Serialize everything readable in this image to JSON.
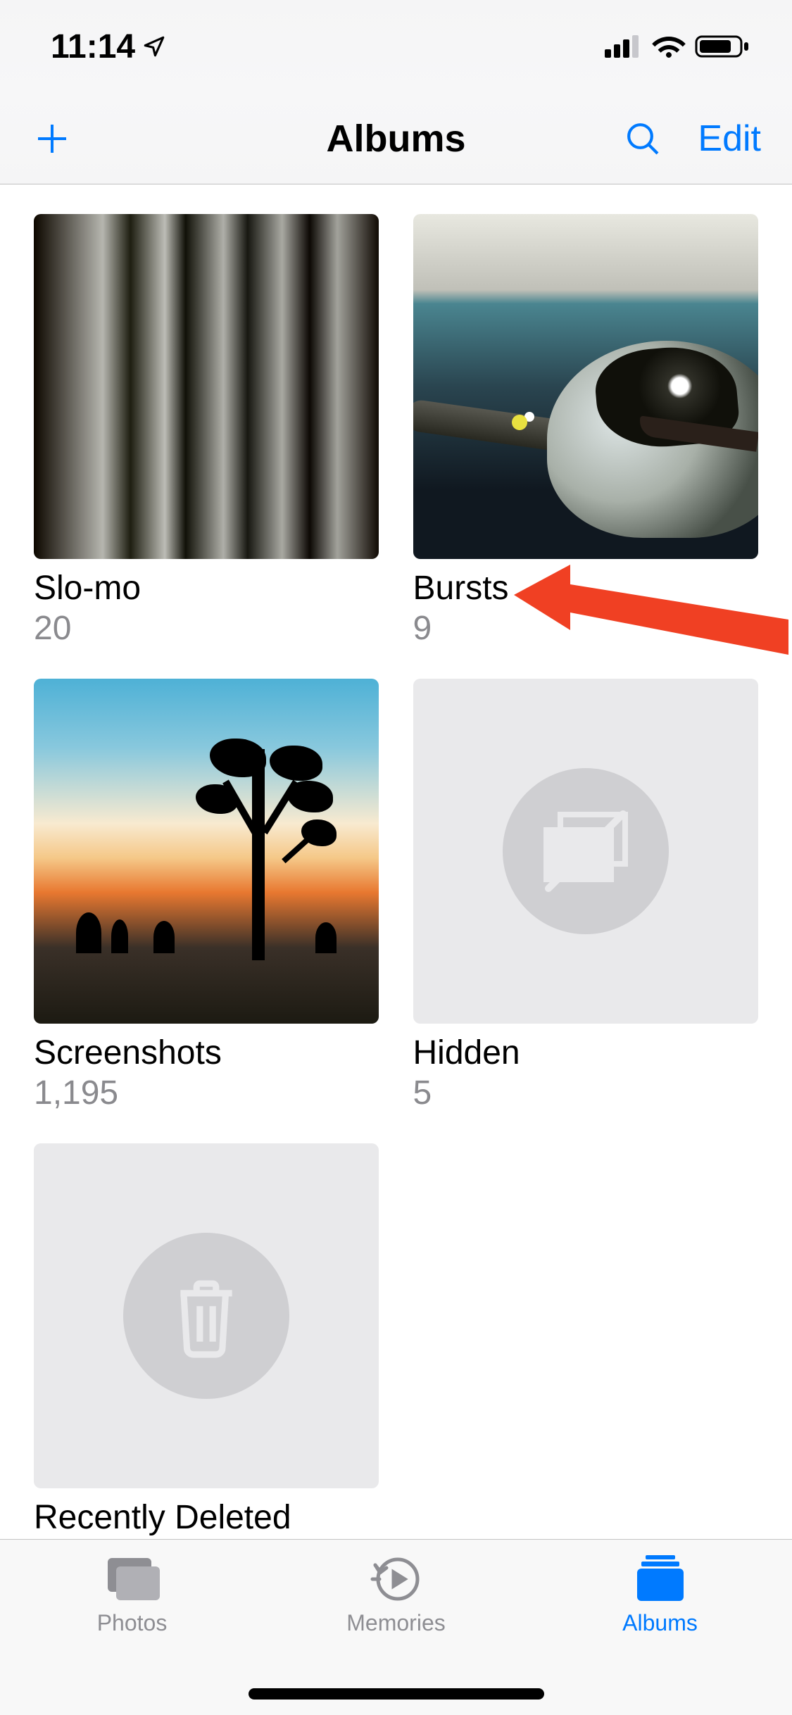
{
  "status": {
    "time": "11:14"
  },
  "nav": {
    "title": "Albums",
    "edit_label": "Edit"
  },
  "albums": [
    {
      "title": "Slo-mo",
      "count": "20"
    },
    {
      "title": "Bursts",
      "count": "9"
    },
    {
      "title": "Screenshots",
      "count": "1,195"
    },
    {
      "title": "Hidden",
      "count": "5"
    },
    {
      "title": "Recently Deleted",
      "count": ""
    }
  ],
  "tabs": {
    "photos": "Photos",
    "memories": "Memories",
    "albums": "Albums"
  }
}
